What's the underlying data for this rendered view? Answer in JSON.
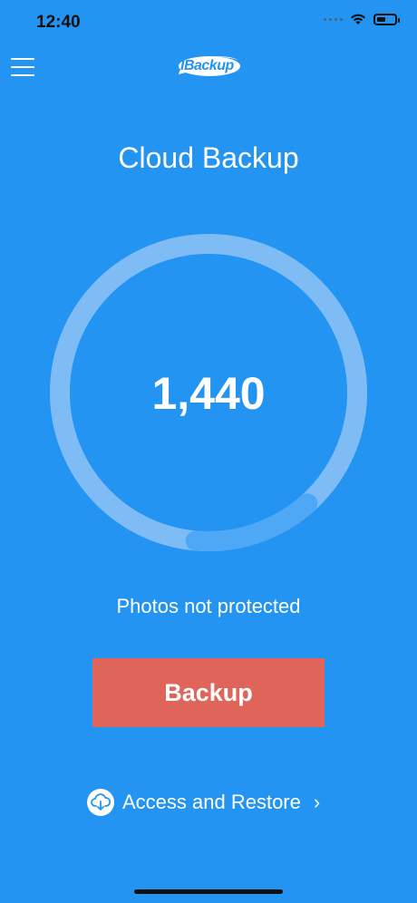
{
  "status_bar": {
    "time": "12:40",
    "icons": [
      "signal-icon",
      "wifi-icon",
      "battery-icon"
    ]
  },
  "header": {
    "menu_icon": "hamburger-menu-icon",
    "logo_text": "IBackup"
  },
  "main": {
    "title": "Cloud Backup",
    "count": "1,440",
    "status_text": "Photos not protected",
    "backup_label": "Backup",
    "restore_label": "Access and Restore",
    "progress_fraction": 0.13
  },
  "colors": {
    "background": "#2394f2",
    "ring_track": "#7fbcf6",
    "ring_progress": "#4ea8f5",
    "backup_button": "#df655b",
    "text": "#ffffff"
  }
}
